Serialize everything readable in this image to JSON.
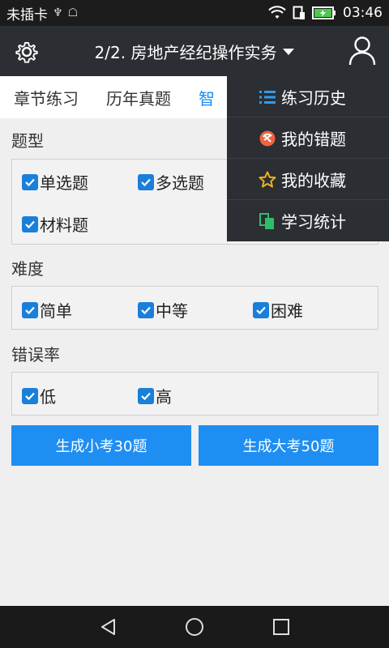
{
  "status_bar": {
    "carrier": "未插卡",
    "usb_glyph": "♆",
    "android_glyph": "☖",
    "time": "03:46"
  },
  "app_bar": {
    "title": "2/2. 房地产经纪操作实务"
  },
  "tabs": [
    {
      "label": "章节练习"
    },
    {
      "label": "历年真题"
    },
    {
      "label": "智"
    }
  ],
  "sections": {
    "question_type": {
      "label": "题型",
      "options": [
        {
          "label": "单选题",
          "checked": true
        },
        {
          "label": "多选题",
          "checked": true
        },
        {
          "label": "材料题",
          "checked": true
        }
      ]
    },
    "difficulty": {
      "label": "难度",
      "options": [
        {
          "label": "简单",
          "checked": true
        },
        {
          "label": "中等",
          "checked": true
        },
        {
          "label": "困难",
          "checked": true
        }
      ]
    },
    "error_rate": {
      "label": "错误率",
      "options": [
        {
          "label": "低",
          "checked": true
        },
        {
          "label": "高",
          "checked": true
        }
      ]
    }
  },
  "buttons": {
    "small_exam": "生成小考30题",
    "big_exam": "生成大考50题"
  },
  "menu": {
    "items": [
      {
        "label": "练习历史",
        "icon": "list-icon",
        "icon_color": "#2d9cf5"
      },
      {
        "label": "我的错题",
        "icon": "error-book-icon",
        "icon_color": "#f0643c"
      },
      {
        "label": "我的收藏",
        "icon": "star-icon",
        "icon_color": "#f2b01e"
      },
      {
        "label": "学习统计",
        "icon": "stats-icon",
        "icon_color": "#2fbd6a"
      }
    ]
  },
  "colors": {
    "accent": "#1e8ef2",
    "header": "#2b2e33",
    "checkbox": "#1a7fd9"
  }
}
